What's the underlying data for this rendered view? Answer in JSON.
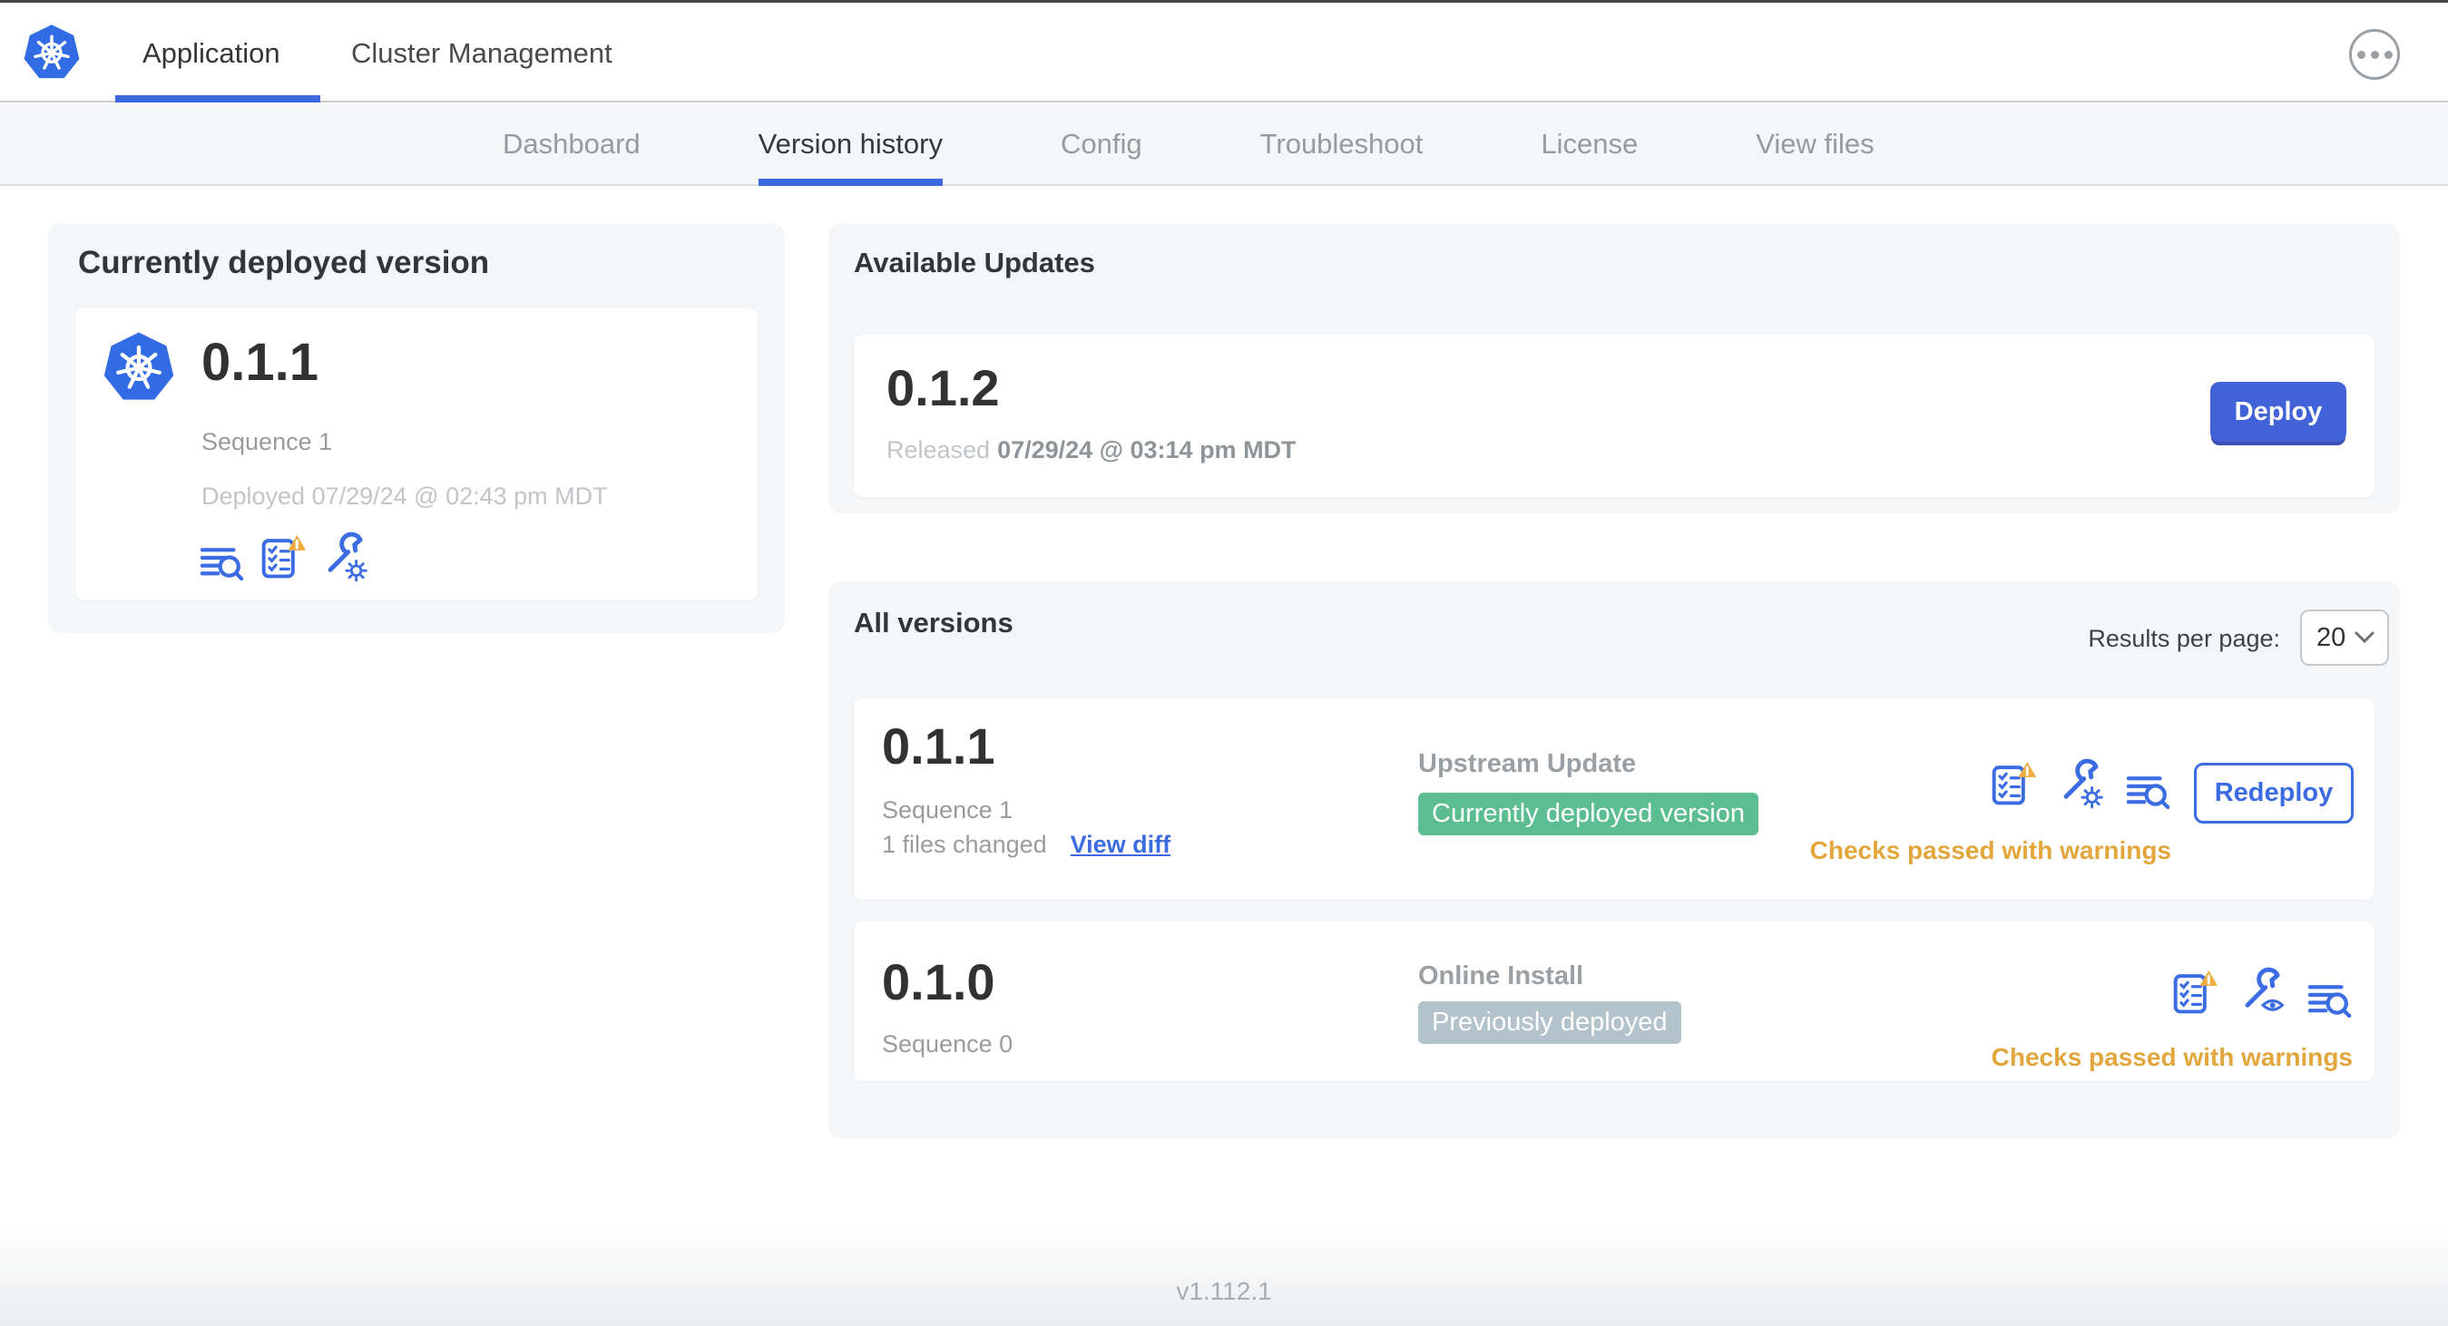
{
  "header": {
    "logo_icon": "kubernetes-logo",
    "tabs": [
      {
        "label": "Application",
        "active": true
      },
      {
        "label": "Cluster Management",
        "active": false
      }
    ],
    "menu_icon": "ellipsis-menu-icon"
  },
  "subnav": {
    "items": [
      {
        "label": "Dashboard",
        "active": false
      },
      {
        "label": "Version history",
        "active": true
      },
      {
        "label": "Config",
        "active": false
      },
      {
        "label": "Troubleshoot",
        "active": false
      },
      {
        "label": "License",
        "active": false
      },
      {
        "label": "View files",
        "active": false
      }
    ]
  },
  "current_version": {
    "title": "Currently deployed version",
    "version": "0.1.1",
    "sequence": "Sequence 1",
    "deployed": "Deployed 07/29/24 @ 02:43 pm MDT",
    "icons": [
      "logs-diff-icon",
      "preflight-checks-warning-icon",
      "config-wrench-gear-icon"
    ]
  },
  "available_updates": {
    "title": "Available Updates",
    "version": "0.1.2",
    "released_prefix": "Released",
    "released_date": "07/29/24 @ 03:14 pm MDT",
    "deploy_label": "Deploy"
  },
  "all_versions": {
    "title": "All versions",
    "results_per_page_label": "Results per page:",
    "results_per_page_value": "20",
    "rows": [
      {
        "version": "0.1.1",
        "sequence": "Sequence 1",
        "files_changed": "1 files changed",
        "view_diff_label": "View diff",
        "source": "Upstream Update",
        "badge": "Currently deployed version",
        "badge_color": "green",
        "icons": [
          "preflight-checks-warning-icon",
          "config-wrench-gear-icon",
          "logs-diff-icon"
        ],
        "action_label": "Redeploy",
        "status": "Checks passed with warnings"
      },
      {
        "version": "0.1.0",
        "sequence": "Sequence 0",
        "source": "Online Install",
        "badge": "Previously deployed",
        "badge_color": "gray",
        "icons": [
          "preflight-checks-warning-icon",
          "config-wrench-view-icon",
          "logs-diff-icon"
        ],
        "status": "Checks passed with warnings"
      }
    ]
  },
  "footer": {
    "app_version": "v1.112.1"
  },
  "colors": {
    "accent_blue": "#3B6CE1",
    "button_blue": "#4263D8",
    "green": "#5CBE90",
    "gray": "#B3C2CB",
    "warning_text": "#E2A63D",
    "warning_fill": "#EFAC3F",
    "k8s_blue": "#326CE5"
  }
}
